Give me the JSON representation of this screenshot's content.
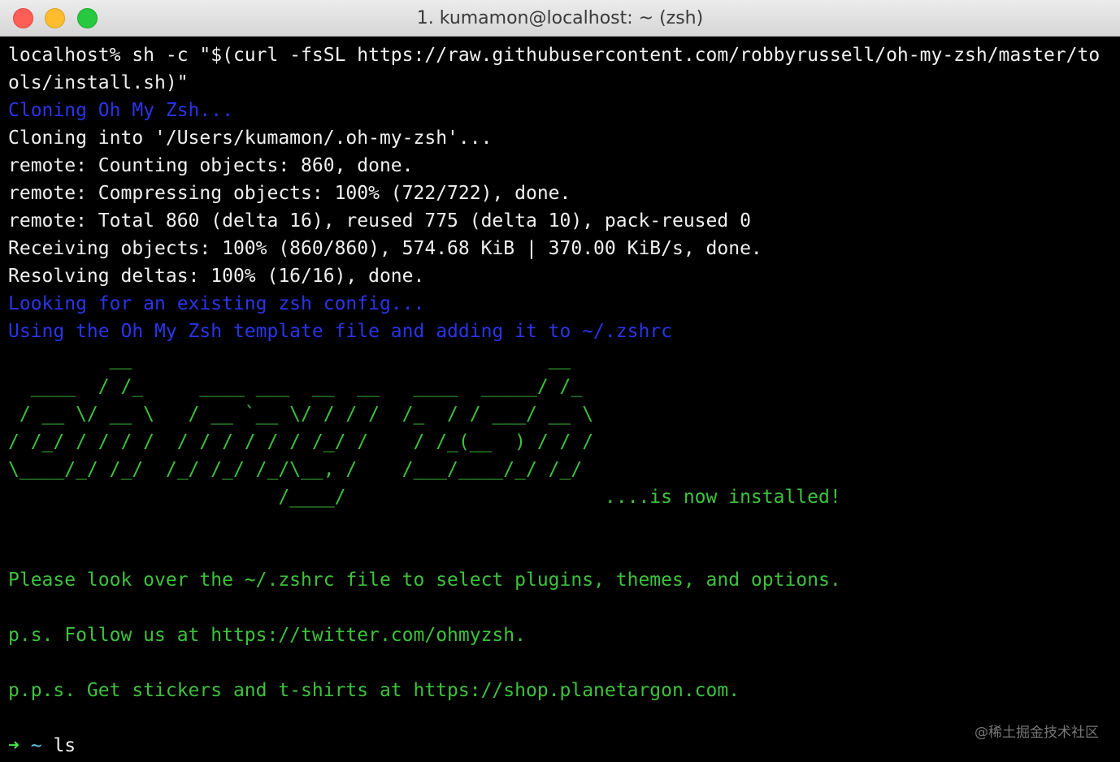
{
  "window": {
    "title": "1. kumamon@localhost: ~ (zsh)"
  },
  "terminal": {
    "lines": [
      "localhost% sh -c \"$(curl -fsSL https://raw.githubusercontent.com/robbyrussell/oh-my-zsh/master/to",
      "ols/install.sh)\"",
      "Cloning Oh My Zsh...",
      "Cloning into '/Users/kumamon/.oh-my-zsh'...",
      "remote: Counting objects: 860, done.",
      "remote: Compressing objects: 100% (722/722), done.",
      "remote: Total 860 (delta 16), reused 775 (delta 10), pack-reused 0",
      "Receiving objects: 100% (860/860), 574.68 KiB | 370.00 KiB/s, done.",
      "Resolving deltas: 100% (16/16), done.",
      "Looking for an existing zsh config...",
      "Using the Oh My Zsh template file and adding it to ~/.zshrc",
      "         __                                     __   ",
      "  ____  / /_     ____ ___  __  __   ____  _____/ /_  ",
      " / __ \\/ __ \\   / __ `__ \\/ / / /  /_  / / ___/ __ \\ ",
      "/ /_/ / / / /  / / / / / / /_/ /    / /_(__  ) / / / ",
      "\\____/_/ /_/  /_/ /_/ /_/\\__, /    /___/____/_/ /_/  ",
      "                        /____/                       ....is now installed!",
      "",
      "",
      "Please look over the ~/.zshrc file to select plugins, themes, and options.",
      "",
      "p.s. Follow us at https://twitter.com/ohmyzsh.",
      "",
      "p.p.s. Get stickers and t-shirts at https://shop.planetargon.com.",
      ""
    ],
    "prompt_arrow": "➜",
    "prompt_dir": "~",
    "prompt_command": "ls"
  },
  "watermark": "@稀土掘金技术社区",
  "colors": {
    "background": "#000000",
    "text": "#f0f0f0",
    "info": "#2a35e8",
    "success": "#3dc23d"
  }
}
